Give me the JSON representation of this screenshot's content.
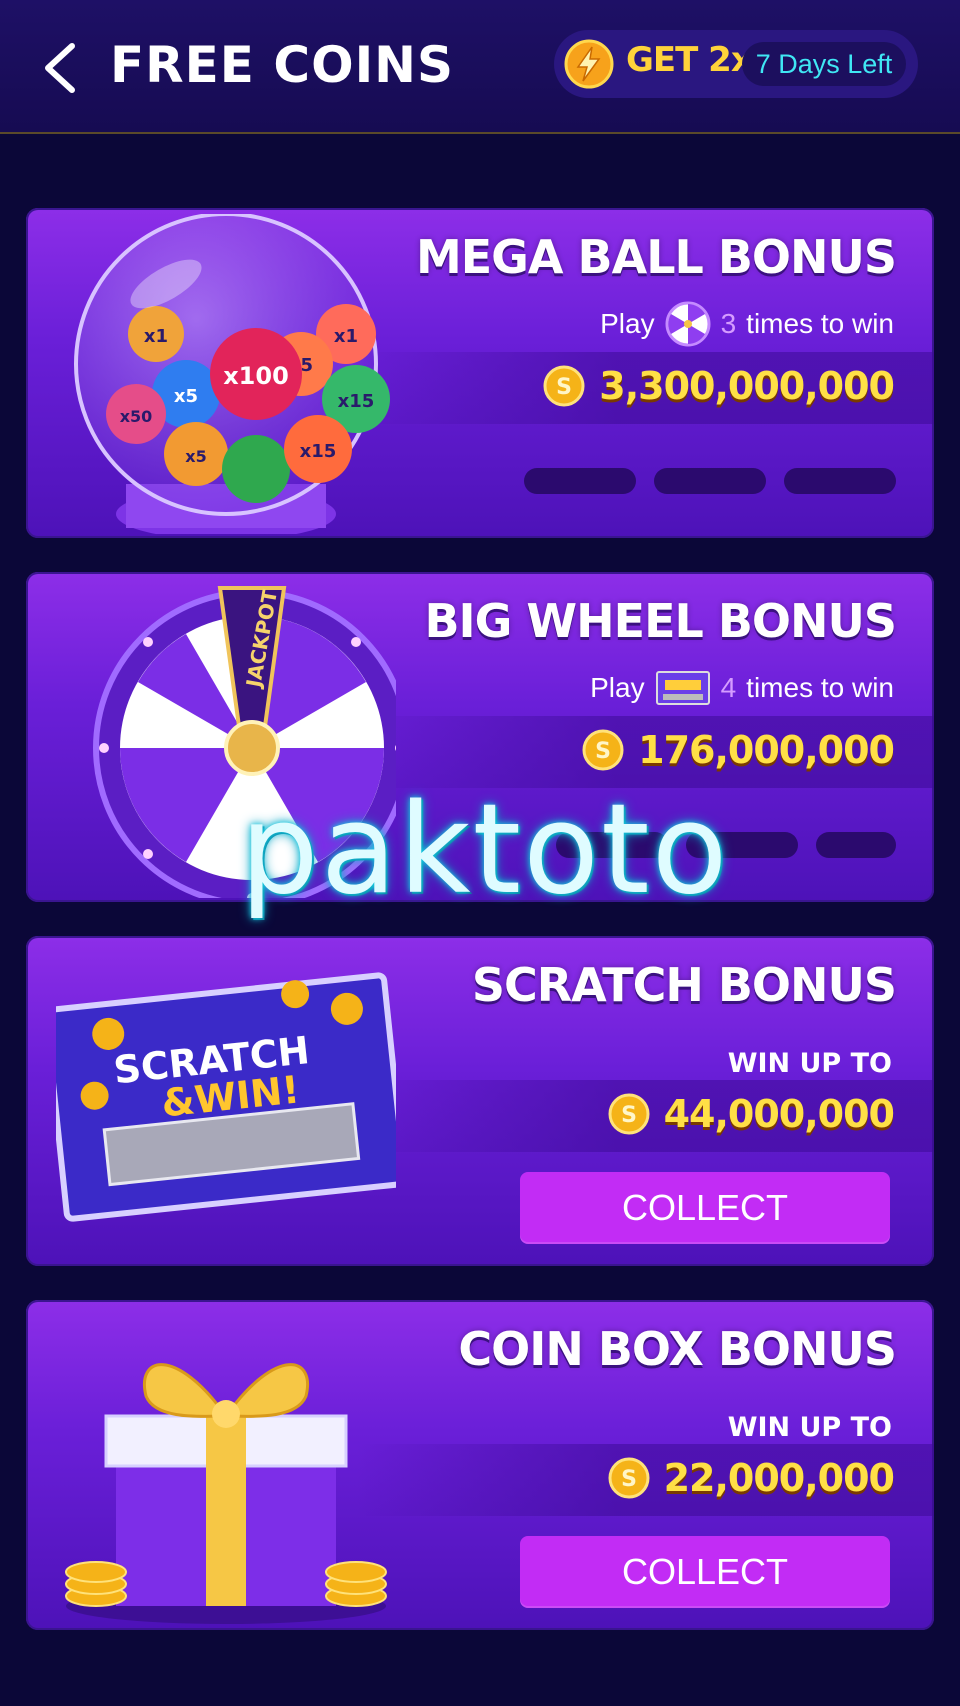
{
  "header": {
    "title": "FREE COINS",
    "booster_label": "GET 2x",
    "days_left": "7 Days Left"
  },
  "cards": [
    {
      "title": "MEGA BALL BONUS",
      "play_prefix": "Play",
      "play_count": "3",
      "play_suffix": "times to win",
      "amount": "3,300,000,000",
      "ball_labels": [
        "x100",
        "x5",
        "x15",
        "x15",
        "x50",
        "x5",
        "x5",
        "x1"
      ]
    },
    {
      "title": "BIG WHEEL BONUS",
      "play_prefix": "Play",
      "play_count": "4",
      "play_suffix": "times to win",
      "amount": "176,000,000",
      "wheel_label": "JACKPOT"
    },
    {
      "title": "SCRATCH BONUS",
      "win_label": "WIN UP TO",
      "amount": "44,000,000",
      "button": "COLLECT",
      "art_text_1": "SCRATCH",
      "art_text_2": "&WIN!"
    },
    {
      "title": "COIN BOX BONUS",
      "win_label": "WIN UP TO",
      "amount": "22,000,000",
      "button": "COLLECT"
    }
  ],
  "watermark": "paktoto",
  "colors": {
    "background": "#0b0738",
    "card": "#7a22e0",
    "amount": "#ffe046",
    "collect_button": "#c22cf5",
    "days_left": "#40e7f4"
  }
}
